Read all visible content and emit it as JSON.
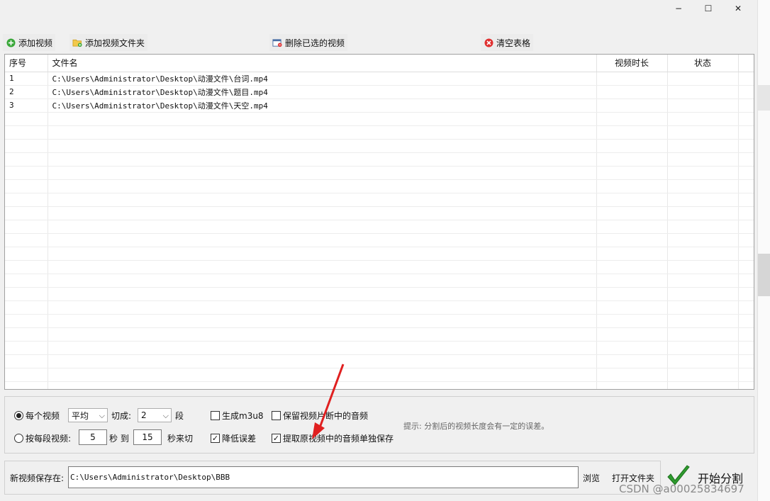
{
  "window": {
    "minimize": "−",
    "maximize": "☐",
    "close": "✕"
  },
  "toolbar": {
    "add_video": "添加视频",
    "add_folder": "添加视频文件夹",
    "delete_selected": "删除已选的视频",
    "clear_table": "清空表格"
  },
  "table": {
    "columns": [
      "序号",
      "文件名",
      "视频时长",
      "状态"
    ],
    "rows": [
      {
        "index": "1",
        "filename": "C:\\Users\\Administrator\\Desktop\\动漫文件\\台词.mp4",
        "duration": "",
        "status": ""
      },
      {
        "index": "2",
        "filename": "C:\\Users\\Administrator\\Desktop\\动漫文件\\题目.mp4",
        "duration": "",
        "status": ""
      },
      {
        "index": "3",
        "filename": "C:\\Users\\Administrator\\Desktop\\动漫文件\\天空.mp4",
        "duration": "",
        "status": ""
      }
    ],
    "empty_rows": 21
  },
  "options": {
    "mode_each": "每个视频",
    "mode_each_selected": true,
    "mode_select_value": "平均",
    "cut_label": "切成:",
    "cut_count": "2",
    "segments_label": "段",
    "mode_per_segment": "按每段视频:",
    "per_from": "5",
    "sec_to_label": "秒 到",
    "per_to": "15",
    "sec_cut_label": "秒来切",
    "gen_m3u8": "生成m3u8",
    "gen_m3u8_checked": false,
    "reduce_error": "降低误差",
    "reduce_error_checked": true,
    "keep_audio": "保留视频片断中的音频",
    "keep_audio_checked": false,
    "extract_audio": "提取原视频中的音频单独保存",
    "extract_audio_checked": true,
    "hint": "提示: 分割后的视频长度会有一定的误差。"
  },
  "save": {
    "label": "新视频保存在:",
    "path": "C:\\Users\\Administrator\\Desktop\\BBB",
    "browse": "浏览",
    "open_folder": "打开文件夹"
  },
  "start": {
    "label": "开始分割"
  },
  "watermark": "CSDN @a00025834697",
  "colors": {
    "accent_green": "#2e9b2e",
    "arrow_red": "#e02020",
    "delete_red": "#e03030"
  }
}
